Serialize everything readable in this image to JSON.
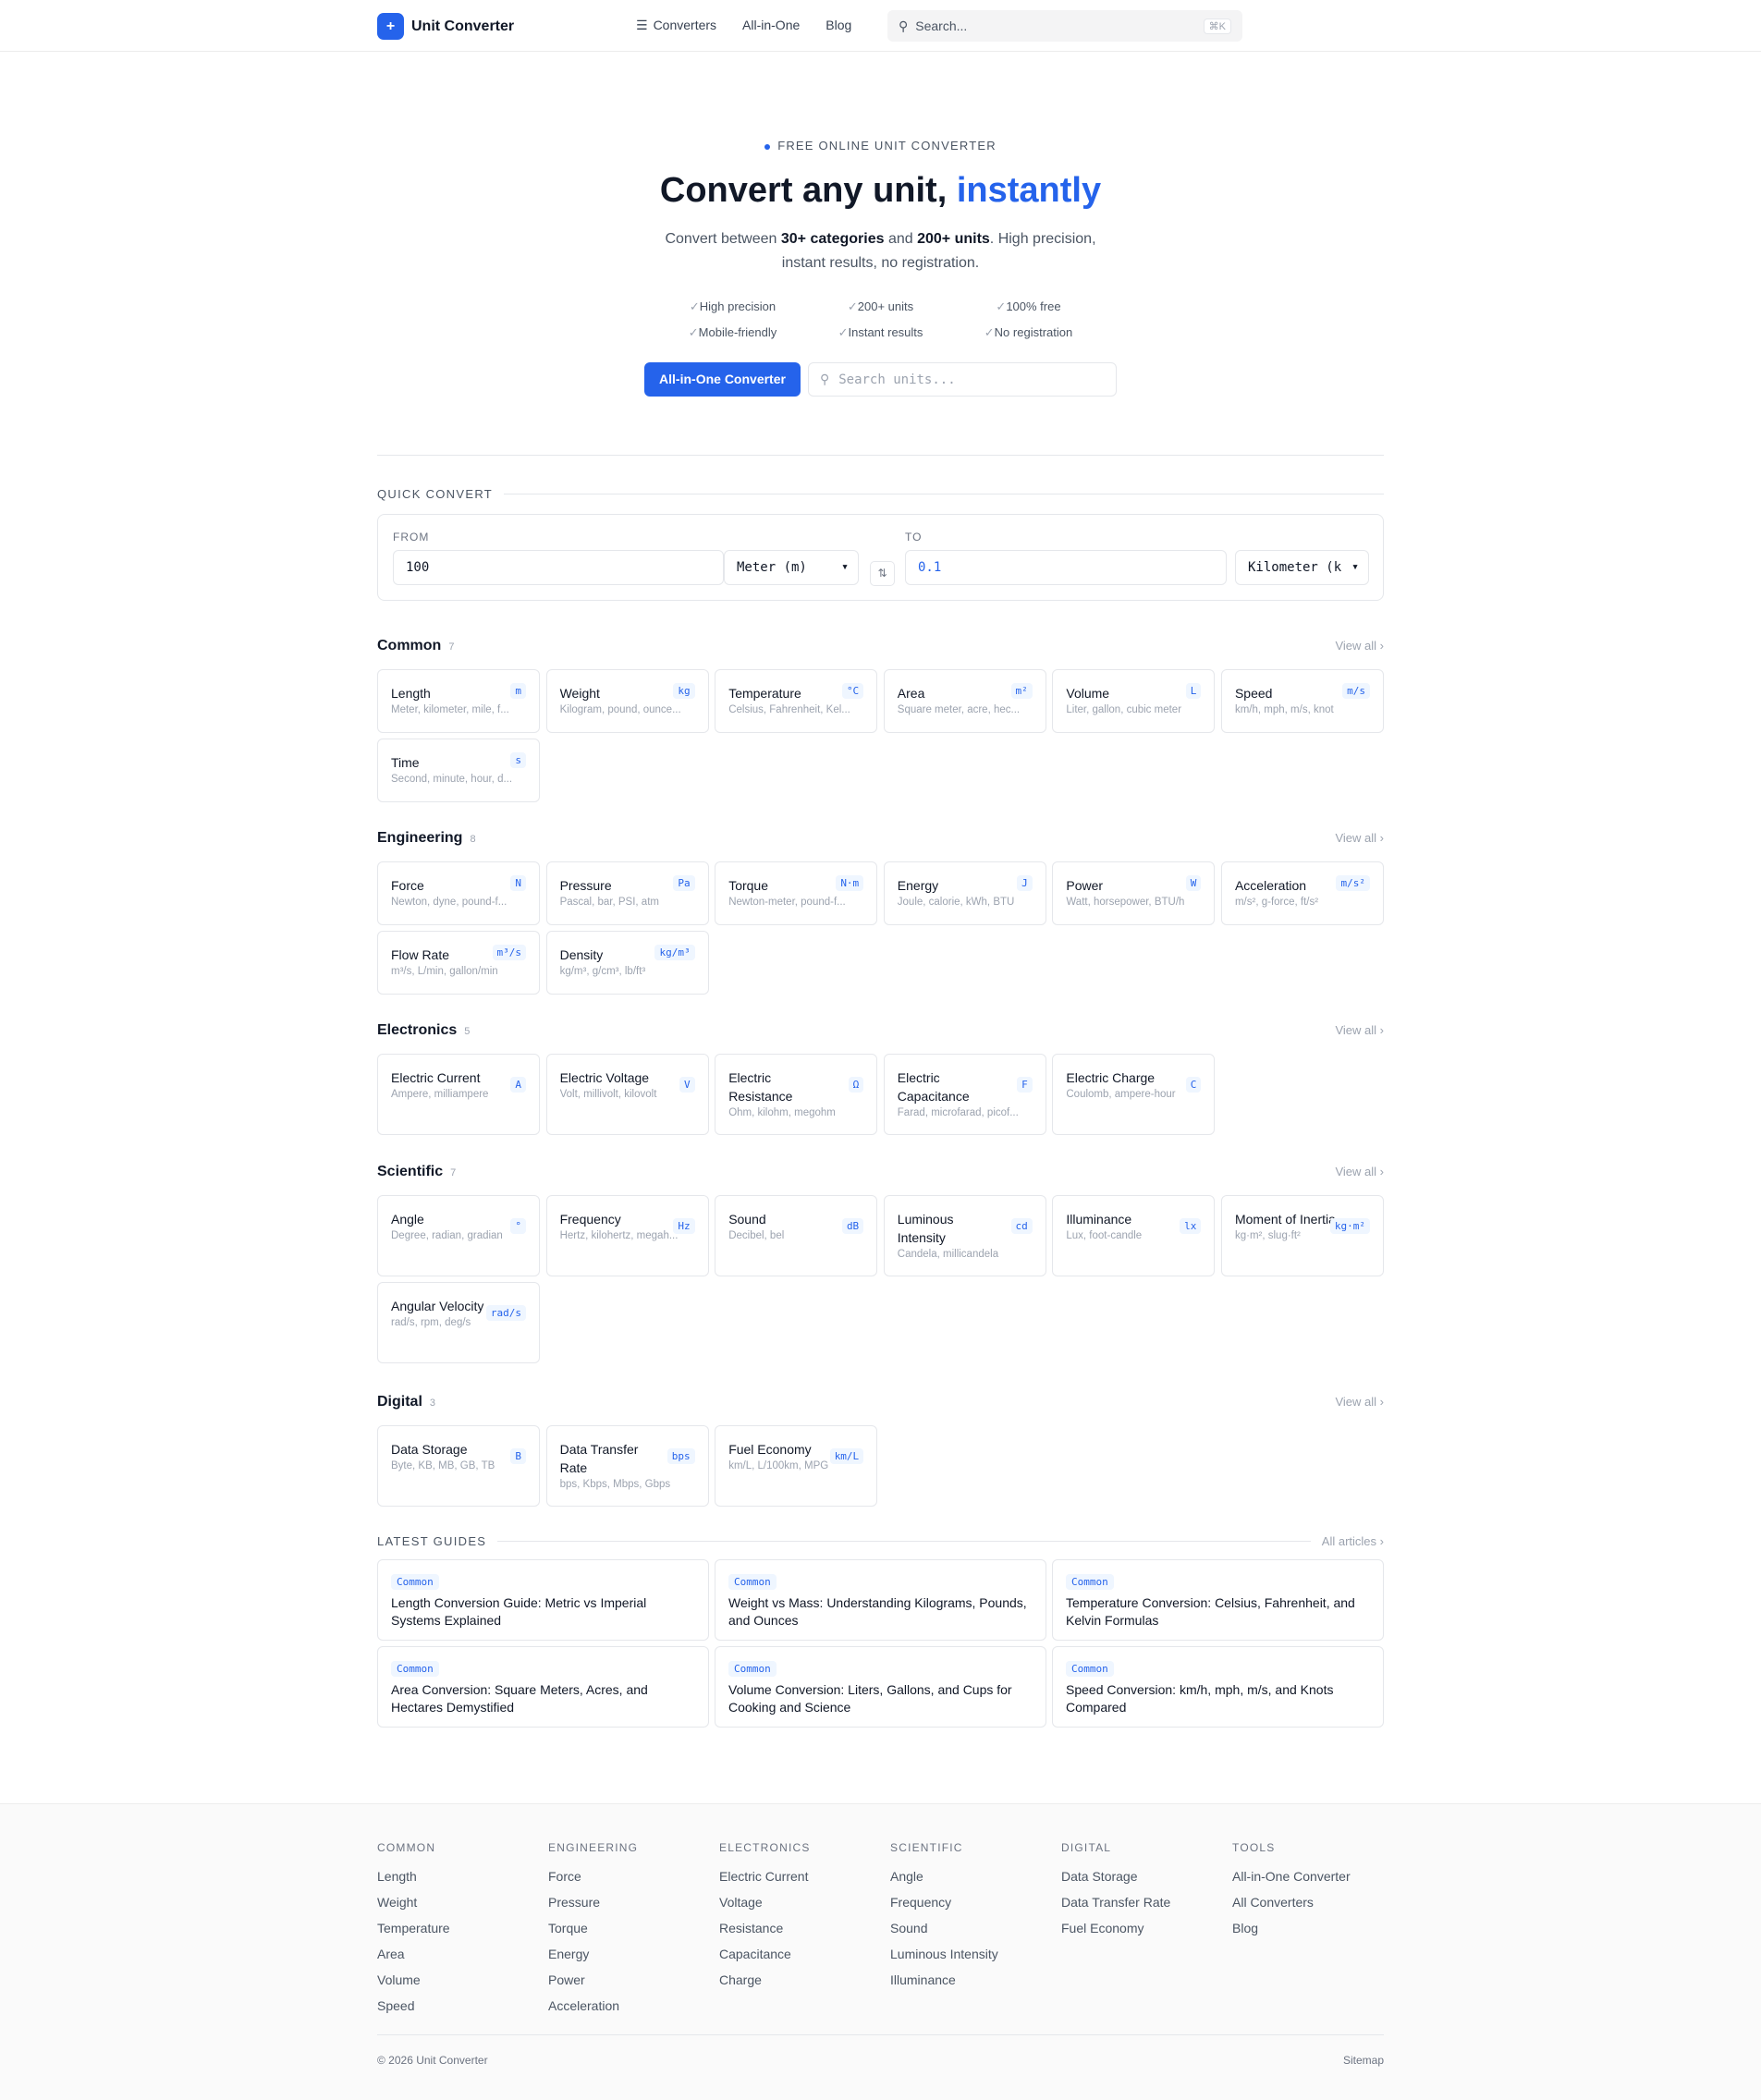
{
  "nav": {
    "brand": "Unit Converter",
    "logo_glyph": "+",
    "links": [
      "Converters",
      "All-in-One",
      "Blog"
    ],
    "search_placeholder": "Search...",
    "search_shortcut": "⌘K"
  },
  "hero": {
    "eyebrow": "FREE ONLINE UNIT CONVERTER",
    "title_main": "Convert any unit, ",
    "title_accent": "instantly",
    "sub_1": "Convert between ",
    "sub_b1": "30+ categories",
    "sub_2": " and ",
    "sub_b2": "200+ units",
    "sub_3": ". High precision, instant results, no registration.",
    "features": [
      "High precision",
      "200+ units",
      "100% free",
      "Mobile-friendly",
      "Instant results",
      "No registration"
    ],
    "cta": "All-in-One Converter",
    "search_placeholder": "Search units..."
  },
  "quick": {
    "title": "QUICK CONVERT",
    "from_label": "FROM",
    "to_label": "TO",
    "from_value": "100",
    "from_unit": "Meter (m)",
    "to_value": "0.1",
    "to_unit": "Kilometer (k"
  },
  "view_all": "View all",
  "categories": [
    {
      "name": "Common",
      "count": "7",
      "cards": [
        {
          "name": "Length",
          "desc": "Meter, kilometer, mile, f...",
          "badge": "m"
        },
        {
          "name": "Weight",
          "desc": "Kilogram, pound, ounce...",
          "badge": "kg"
        },
        {
          "name": "Temperature",
          "desc": "Celsius, Fahrenheit, Kel...",
          "badge": "°C"
        },
        {
          "name": "Area",
          "desc": "Square meter, acre, hec...",
          "badge": "m²"
        },
        {
          "name": "Volume",
          "desc": "Liter, gallon, cubic meter",
          "badge": "L"
        },
        {
          "name": "Speed",
          "desc": "km/h, mph, m/s, knot",
          "badge": "m/s"
        },
        {
          "name": "Time",
          "desc": "Second, minute, hour, d...",
          "badge": "s"
        }
      ]
    },
    {
      "name": "Engineering",
      "count": "8",
      "cards": [
        {
          "name": "Force",
          "desc": "Newton, dyne, pound-f...",
          "badge": "N"
        },
        {
          "name": "Pressure",
          "desc": "Pascal, bar, PSI, atm",
          "badge": "Pa"
        },
        {
          "name": "Torque",
          "desc": "Newton-meter, pound-f...",
          "badge": "N·m"
        },
        {
          "name": "Energy",
          "desc": "Joule, calorie, kWh, BTU",
          "badge": "J"
        },
        {
          "name": "Power",
          "desc": "Watt, horsepower, BTU/h",
          "badge": "W"
        },
        {
          "name": "Acceleration",
          "desc": "m/s², g-force, ft/s²",
          "badge": "m/s²"
        },
        {
          "name": "Flow Rate",
          "desc": "m³/s, L/min, gallon/min",
          "badge": "m³/s"
        },
        {
          "name": "Density",
          "desc": "kg/m³, g/cm³, lb/ft³",
          "badge": "kg/m³"
        }
      ]
    },
    {
      "name": "Electronics",
      "count": "5",
      "cards": [
        {
          "name": "Electric Current",
          "desc": "Ampere, milliampere",
          "badge": "A"
        },
        {
          "name": "Electric Voltage",
          "desc": "Volt, millivolt, kilovolt",
          "badge": "V"
        },
        {
          "name": "Electric Resistance",
          "desc": "Ohm, kilohm, megohm",
          "badge": "Ω"
        },
        {
          "name": "Electric Capacitance",
          "desc": "Farad, microfarad, picof...",
          "badge": "F",
          "tall": true
        },
        {
          "name": "Electric Charge",
          "desc": "Coulomb, ampere-hour",
          "badge": "C"
        }
      ]
    },
    {
      "name": "Scientific",
      "count": "7",
      "cards": [
        {
          "name": "Angle",
          "desc": "Degree, radian, gradian",
          "badge": "°"
        },
        {
          "name": "Frequency",
          "desc": "Hertz, kilohertz, megah...",
          "badge": "Hz"
        },
        {
          "name": "Sound",
          "desc": "Decibel, bel",
          "badge": "dB"
        },
        {
          "name": "Luminous Intensity",
          "desc": "Candela, millicandela",
          "badge": "cd",
          "tall": true
        },
        {
          "name": "Illuminance",
          "desc": "Lux, foot-candle",
          "badge": "lx"
        },
        {
          "name": "Moment of Inertia",
          "desc": "kg·m², slug·ft²",
          "badge": "kg·m²",
          "tall": true
        },
        {
          "name": "Angular Velocity",
          "desc": "rad/s, rpm, deg/s",
          "badge": "rad/s",
          "tall": true
        }
      ]
    },
    {
      "name": "Digital",
      "count": "3",
      "cards": [
        {
          "name": "Data Storage",
          "desc": "Byte, KB, MB, GB, TB",
          "badge": "B"
        },
        {
          "name": "Data Transfer Rate",
          "desc": "bps, Kbps, Mbps, Gbps",
          "badge": "bps",
          "tall": true
        },
        {
          "name": "Fuel Economy",
          "desc": "km/L, L/100km, MPG",
          "badge": "km/L"
        }
      ]
    }
  ],
  "guides": {
    "title": "LATEST GUIDES",
    "all": "All articles",
    "items": [
      {
        "tag": "Common",
        "title": "Length Conversion Guide: Metric vs Imperial Systems Explained"
      },
      {
        "tag": "Common",
        "title": "Weight vs Mass: Understanding Kilograms, Pounds, and Ounces"
      },
      {
        "tag": "Common",
        "title": "Temperature Conversion: Celsius, Fahrenheit, and Kelvin Formulas"
      },
      {
        "tag": "Common",
        "title": "Area Conversion: Square Meters, Acres, and Hectares Demystified"
      },
      {
        "tag": "Common",
        "title": "Volume Conversion: Liters, Gallons, and Cups for Cooking and Science"
      },
      {
        "tag": "Common",
        "title": "Speed Conversion: km/h, mph, m/s, and Knots Compared"
      }
    ]
  },
  "footer": {
    "columns": [
      {
        "title": "COMMON",
        "links": [
          "Length",
          "Weight",
          "Temperature",
          "Area",
          "Volume",
          "Speed"
        ]
      },
      {
        "title": "ENGINEERING",
        "links": [
          "Force",
          "Pressure",
          "Torque",
          "Energy",
          "Power",
          "Acceleration"
        ]
      },
      {
        "title": "ELECTRONICS",
        "links": [
          "Electric Current",
          "Voltage",
          "Resistance",
          "Capacitance",
          "Charge"
        ]
      },
      {
        "title": "SCIENTIFIC",
        "links": [
          "Angle",
          "Frequency",
          "Sound",
          "Luminous Intensity",
          "Illuminance"
        ]
      },
      {
        "title": "DIGITAL",
        "links": [
          "Data Storage",
          "Data Transfer Rate",
          "Fuel Economy"
        ]
      },
      {
        "title": "TOOLS",
        "links": [
          "All-in-One Converter",
          "All Converters",
          "Blog"
        ]
      }
    ],
    "copyright": "© 2026 Unit Converter",
    "sitemap": "Sitemap"
  }
}
